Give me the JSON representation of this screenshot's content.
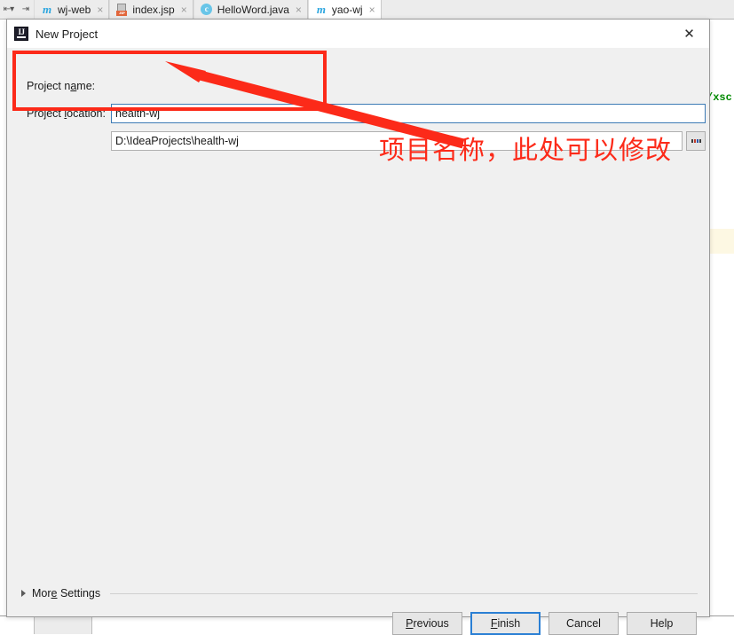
{
  "ide": {
    "toolbar_icons": [
      {
        "name": "collapse-all-icon",
        "glyph": "⇤▾"
      },
      {
        "name": "jump-to-source-icon",
        "glyph": "⇥"
      }
    ],
    "editor_tabs": [
      {
        "icon": "maven-module-icon",
        "icon_type": "maven",
        "label": "wj-web",
        "close": "×",
        "active": false
      },
      {
        "icon": "jsp-file-icon",
        "icon_type": "jsp",
        "label": "index.jsp",
        "close": "×",
        "active": false
      },
      {
        "icon": "java-class-icon",
        "icon_type": "class",
        "label": "HelloWord.java",
        "close": "×",
        "active": false
      },
      {
        "icon": "maven-module-icon",
        "icon_type": "maven",
        "label": "yao-wj",
        "close": "×",
        "active": true
      }
    ],
    "code_snippet": "/xsc"
  },
  "dialog": {
    "title": "New Project",
    "app_icon_label": "IJ",
    "close_label": "✕",
    "fields": {
      "project_name": {
        "label_prefix": "Project n",
        "label_mnemonic": "a",
        "label_suffix": "me:",
        "value": "health-wj",
        "placeholder": ""
      },
      "project_location": {
        "label_prefix": "Project ",
        "label_mnemonic": "l",
        "label_suffix": "ocation:",
        "value": "D:\\IdeaProjects\\health-wj",
        "placeholder": ""
      },
      "browse_button_label": "..."
    },
    "more_settings": {
      "prefix": "Mor",
      "mnemonic": "e",
      "suffix": " Settings"
    },
    "buttons": [
      {
        "name": "previous-button",
        "prefix": "",
        "mnemonic": "P",
        "suffix": "revious",
        "default": false
      },
      {
        "name": "finish-button",
        "prefix": "",
        "mnemonic": "F",
        "suffix": "inish",
        "default": true
      },
      {
        "name": "cancel-button",
        "prefix": "Cancel",
        "mnemonic": "",
        "suffix": "",
        "default": false
      },
      {
        "name": "help-button",
        "prefix": "Help",
        "mnemonic": "",
        "suffix": "",
        "default": false
      }
    ]
  },
  "annotation": {
    "text": "项目名称，此处可以修改",
    "color": "#fc2a19"
  }
}
